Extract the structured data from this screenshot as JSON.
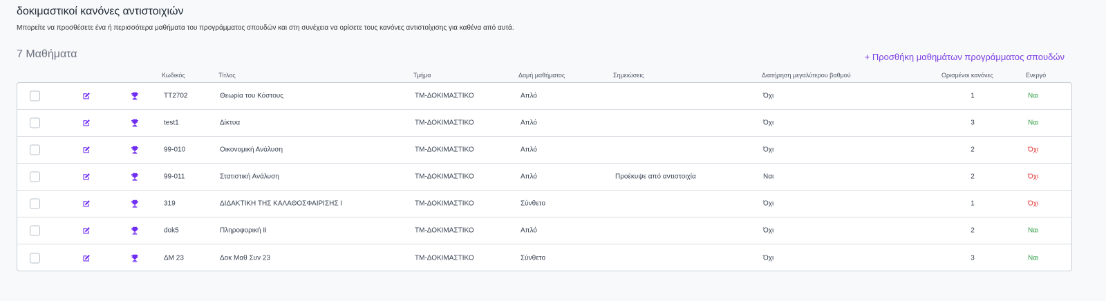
{
  "header": {
    "title": "δοκιμαστικοί κανόνες αντιστοιχιών",
    "subtitle": "Μπορείτε να προσθέσετε ένα ή περισσότερα μαθήματα του προγράμματος σπουδών και στη συνέχεια να ορίσετε τους κανόνες αντιστοίχισης για καθένα από αυτά.",
    "count_title": "7 Μαθήματα",
    "add_link": "+ Προσθήκη μαθημάτων προγράμματος σπουδών"
  },
  "columns": {
    "code": "Κωδικός",
    "title": "Τίτλος",
    "department": "Τμήμα",
    "structure": "Δομή μαθήματος",
    "notes": "Σημειώσεις",
    "keep_grade": "Διατήρηση μεγαλύτερου βαθμού",
    "rules": "Ορισμένοι κανόνες",
    "active": "Ενεργό"
  },
  "icons": {
    "edit": "edit-icon",
    "rules": "trophy-icon",
    "accent_color": "#6f2cf3",
    "yes_color": "#2f9e44",
    "no_color": "#e03131"
  },
  "rows": [
    {
      "code": "TT2702",
      "title": "Θεωρία του Κόστους",
      "department": "ΤΜ-ΔΟΚΙΜΑΣΤΙΚΟ",
      "structure": "Απλό",
      "notes": "",
      "keep_grade": "Όχι",
      "rules": "1",
      "active": "Ναι"
    },
    {
      "code": "test1",
      "title": "Δίκτυα",
      "department": "ΤΜ-ΔΟΚΙΜΑΣΤΙΚΟ",
      "structure": "Απλό",
      "notes": "",
      "keep_grade": "Όχι",
      "rules": "3",
      "active": "Ναι"
    },
    {
      "code": "99-010",
      "title": "Οικονομική Ανάλυση",
      "department": "ΤΜ-ΔΟΚΙΜΑΣΤΙΚΟ",
      "structure": "Απλό",
      "notes": "",
      "keep_grade": "Όχι",
      "rules": "2",
      "active": "Όχι"
    },
    {
      "code": "99-011",
      "title": "Στατιστική Ανάλυση",
      "department": "ΤΜ-ΔΟΚΙΜΑΣΤΙΚΟ",
      "structure": "Απλό",
      "notes": "Προέκυψε από αντιστοιχία",
      "keep_grade": "Ναι",
      "rules": "2",
      "active": "Όχι"
    },
    {
      "code": "319",
      "title": "ΔΙΔΑΚΤΙΚΗ ΤΗΣ ΚΑΛΑΘΟΣΦΑΙΡΙΣΗΣ Ι",
      "department": "ΤΜ-ΔΟΚΙΜΑΣΤΙΚΟ",
      "structure": "Σύνθετο",
      "notes": "",
      "keep_grade": "Όχι",
      "rules": "1",
      "active": "Όχι"
    },
    {
      "code": "dok5",
      "title": "Πληροφορική ΙΙ",
      "department": "ΤΜ-ΔΟΚΙΜΑΣΤΙΚΟ",
      "structure": "Απλό",
      "notes": "",
      "keep_grade": "Όχι",
      "rules": "2",
      "active": "Ναι"
    },
    {
      "code": "ΔΜ 23",
      "title": "Δοκ Μαθ Συν 23",
      "department": "ΤΜ-ΔΟΚΙΜΑΣΤΙΚΟ",
      "structure": "Σύνθετο",
      "notes": "",
      "keep_grade": "Όχι",
      "rules": "3",
      "active": "Ναι"
    }
  ]
}
